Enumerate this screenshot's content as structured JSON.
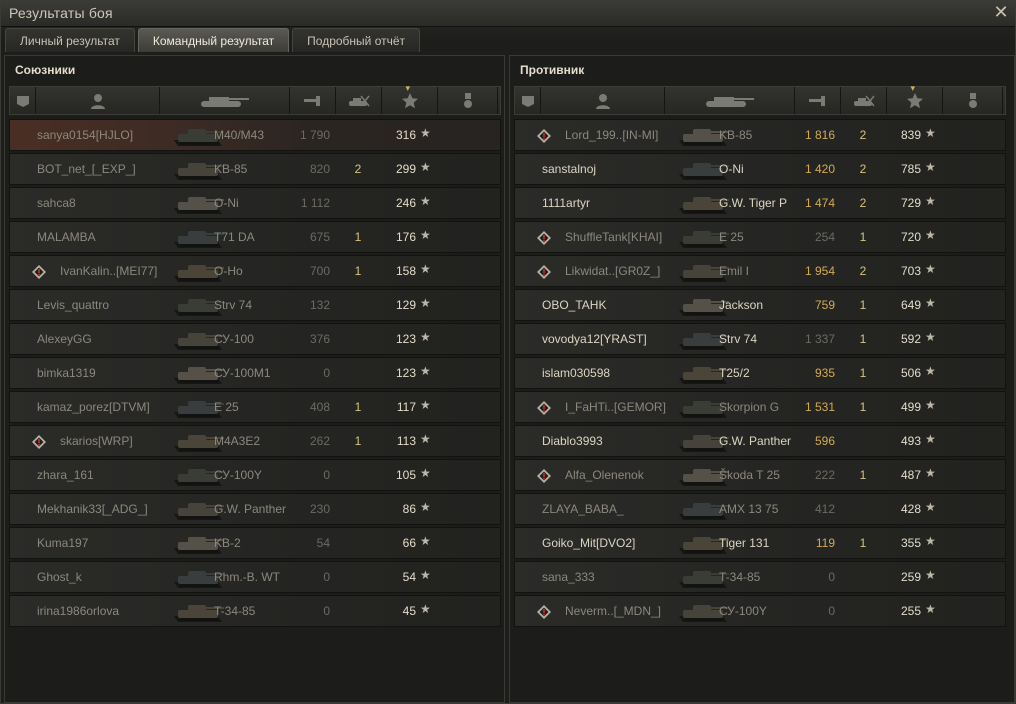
{
  "window": {
    "title": "Результаты боя"
  },
  "tabs": [
    {
      "label": "Личный результат"
    },
    {
      "label": "Командный результат"
    },
    {
      "label": "Подробный отчёт"
    }
  ],
  "left": {
    "title": "Союзники",
    "rows": [
      {
        "name": "sanya0154[HJLO]",
        "vehicle": "M40/M43",
        "damage": "1 790",
        "kills": "",
        "xp": "316"
      },
      {
        "name": "BOT_net_[_EXP_]",
        "vehicle": "KB-85",
        "damage": "820",
        "kills": "2",
        "xp": "299"
      },
      {
        "name": "sahca8",
        "vehicle": "O-Ni",
        "damage": "1 112",
        "kills": "",
        "xp": "246"
      },
      {
        "name": "MALAMBA",
        "vehicle": "T71 DA",
        "damage": "675",
        "kills": "1",
        "xp": "176"
      },
      {
        "name": "IvanKalin..[MEI77]",
        "vehicle": "O-Ho",
        "damage": "700",
        "kills": "1",
        "xp": "158"
      },
      {
        "name": "Levis_quattro",
        "vehicle": "Strv 74",
        "damage": "132",
        "kills": "",
        "xp": "129"
      },
      {
        "name": "AlexeyGG",
        "vehicle": "СУ-100",
        "damage": "376",
        "kills": "",
        "xp": "123"
      },
      {
        "name": "bimka1319",
        "vehicle": "СУ-100М1",
        "damage": "0",
        "kills": "",
        "xp": "123"
      },
      {
        "name": "kamaz_porez[DTVM]",
        "vehicle": "E 25",
        "damage": "408",
        "kills": "1",
        "xp": "117"
      },
      {
        "name": "skarios[WRP]",
        "vehicle": "M4A3E2",
        "damage": "262",
        "kills": "1",
        "xp": "113"
      },
      {
        "name": "zhara_161",
        "vehicle": "СУ-100Y",
        "damage": "0",
        "kills": "",
        "xp": "105"
      },
      {
        "name": "Mekhanik33[_ADG_]",
        "vehicle": "G.W. Panther",
        "damage": "230",
        "kills": "",
        "xp": "86"
      },
      {
        "name": "Kuma197",
        "vehicle": "KB-2",
        "damage": "54",
        "kills": "",
        "xp": "66"
      },
      {
        "name": "Ghost_k",
        "vehicle": "Rhm.-B. WT",
        "damage": "0",
        "kills": "",
        "xp": "54"
      },
      {
        "name": "irina1986orlova",
        "vehicle": "T-34-85",
        "damage": "0",
        "kills": "",
        "xp": "45"
      }
    ]
  },
  "right": {
    "title": "Противник",
    "rows": [
      {
        "name": "Lord_199..[IN-MI]",
        "vehicle": "KB-85",
        "damage": "1 816",
        "kills": "2",
        "xp": "839"
      },
      {
        "name": "sanstalnoj",
        "vehicle": "O-Ni",
        "damage": "1 420",
        "kills": "2",
        "xp": "785"
      },
      {
        "name": "1111artyr",
        "vehicle": "G.W. Tiger P",
        "damage": "1 474",
        "kills": "2",
        "xp": "729"
      },
      {
        "name": "ShuffleTank[KHAI]",
        "vehicle": "E 25",
        "damage": "254",
        "kills": "1",
        "xp": "720"
      },
      {
        "name": "Likwidat..[GR0Z_]",
        "vehicle": "Emil I",
        "damage": "1 954",
        "kills": "2",
        "xp": "703"
      },
      {
        "name": "OBO_TAHK",
        "vehicle": "Jackson",
        "damage": "759",
        "kills": "1",
        "xp": "649"
      },
      {
        "name": "vovodya12[YRAST]",
        "vehicle": "Strv 74",
        "damage": "1 337",
        "kills": "1",
        "xp": "592"
      },
      {
        "name": "islam030598",
        "vehicle": "T25/2",
        "damage": "935",
        "kills": "1",
        "xp": "506"
      },
      {
        "name": "I_FaHTi..[GEMOR]",
        "vehicle": "Skorpion G",
        "damage": "1 531",
        "kills": "1",
        "xp": "499"
      },
      {
        "name": "Diablo3993",
        "vehicle": "G.W. Panther",
        "damage": "596",
        "kills": "",
        "xp": "493"
      },
      {
        "name": "Alfa_Olenenok",
        "vehicle": "Škoda T 25",
        "damage": "222",
        "kills": "1",
        "xp": "487"
      },
      {
        "name": "ZLAYA_BABA_",
        "vehicle": "AMX 13 75",
        "damage": "412",
        "kills": "",
        "xp": "428"
      },
      {
        "name": "Goiko_Mit[DVO2]",
        "vehicle": "Tiger 131",
        "damage": "119",
        "kills": "1",
        "xp": "355"
      },
      {
        "name": "sana_333",
        "vehicle": "T-34-85",
        "damage": "0",
        "kills": "",
        "xp": "259"
      },
      {
        "name": "Neverm..[_MDN_]",
        "vehicle": "СУ-100Y",
        "damage": "0",
        "kills": "",
        "xp": "255"
      }
    ]
  },
  "star_glyph": "★",
  "close_glyph": "✕"
}
